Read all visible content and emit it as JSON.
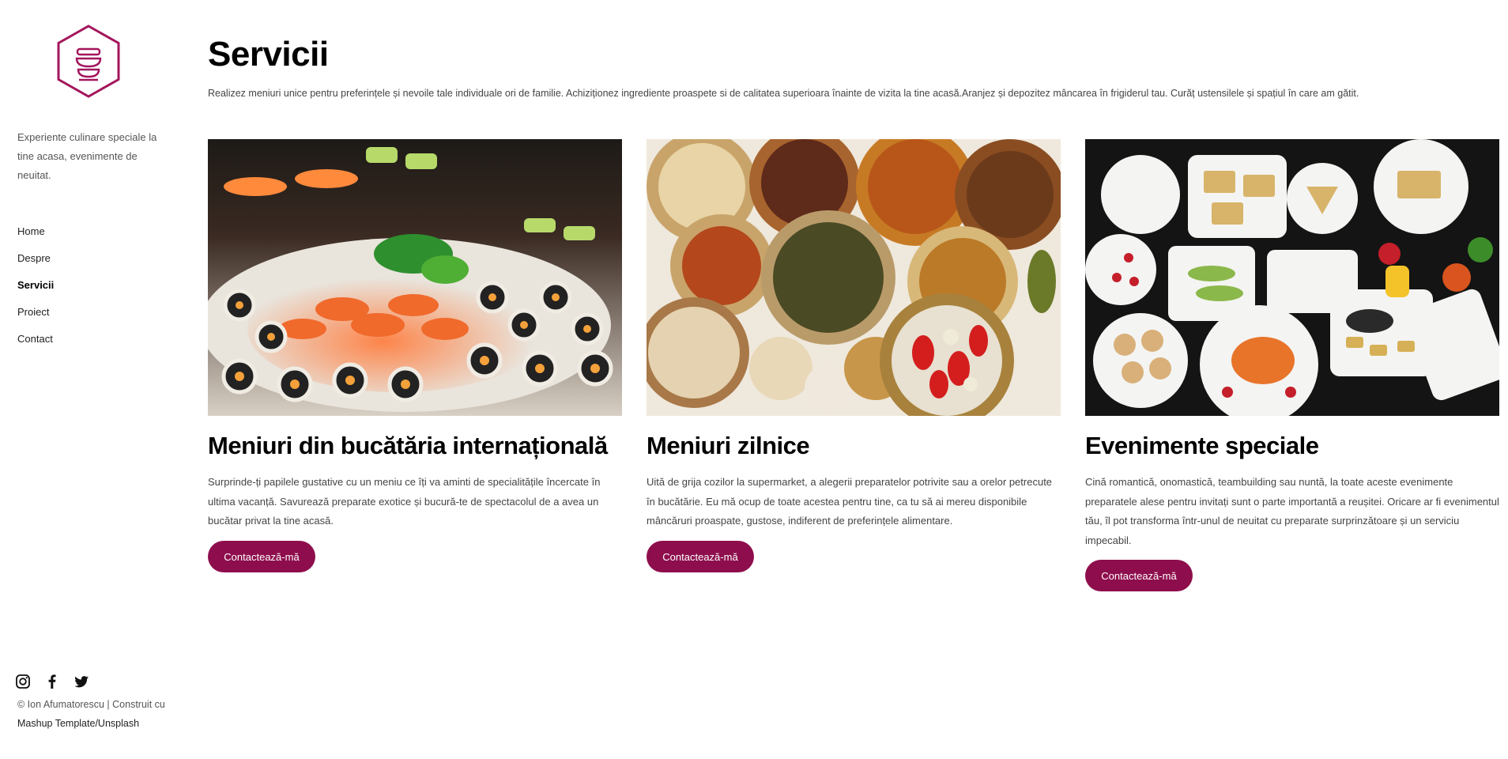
{
  "sidebar": {
    "tagline": "Experiente culinare speciale la tine acasa, evenimente de neuitat.",
    "nav": [
      {
        "label": "Home",
        "active": false
      },
      {
        "label": "Despre",
        "active": false
      },
      {
        "label": "Servicii",
        "active": true
      },
      {
        "label": "Proiect",
        "active": false
      },
      {
        "label": "Contact",
        "active": false
      }
    ],
    "social_icons": [
      "instagram-icon",
      "facebook-icon",
      "twitter-icon"
    ],
    "footer": {
      "copyright": "© Ion Afumatorescu | Construit cu",
      "link": "Mashup Template/Unsplash"
    }
  },
  "main": {
    "title": "Servicii",
    "intro": "Realizez meniuri unice pentru preferințele și nevoile tale individuale ori de familie. Achiziționez ingrediente proaspete si de calitatea superioara înainte de vizita la tine acasă.Aranjez și depozitez mâncarea în frigiderul tau. Curăț ustensilele și spațiul în care am gătit.",
    "cards": [
      {
        "title": "Meniuri din bucătăria internațională",
        "text": "Surprinde-ți papilele gustative cu un meniu ce îți va aminti de specialitățile încercate în ultima vacanță. Savurează preparate exotice și bucură-te de spectacolul de a avea un bucătar privat la tine acasă.",
        "button": "Contactează-mă"
      },
      {
        "title": "Meniuri zilnice",
        "text": "Uită de grija cozilor la supermarket, a alegerii preparatelor potrivite sau a orelor petrecute în bucătărie. Eu mă ocup de toate acestea pentru tine, ca tu să ai mereu disponibile mâncăruri proaspate, gustose, indiferent de preferințele alimentare.",
        "button": "Contactează-mă"
      },
      {
        "title": "Evenimente speciale",
        "text": "Cină romantică, onomastică, teambuilding sau nuntă, la toate aceste evenimente preparatele alese pentru invitați sunt o parte importantă a reușitei. Oricare ar fi evenimentul tău, îl pot transforma într-unul de neuitat cu preparate surprinzătoare și un serviciu impecabil.",
        "button": "Contactează-mă"
      }
    ]
  },
  "colors": {
    "accent": "#8e0e4d",
    "text": "#444444",
    "heading": "#000000"
  }
}
